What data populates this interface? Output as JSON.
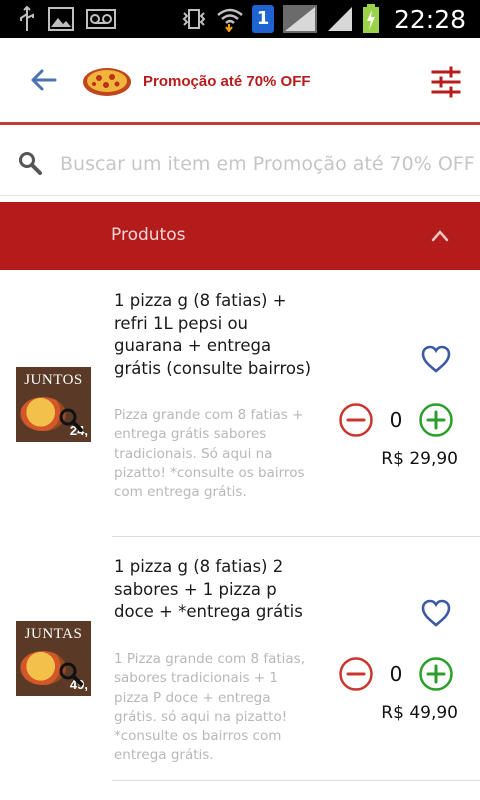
{
  "status_bar": {
    "time": "22:28",
    "sim_badge": "1",
    "icons": [
      "usb-icon",
      "image-icon",
      "voicemail-icon",
      "vibrate-icon",
      "wifi-icon",
      "signal-icon",
      "battery-charging-icon"
    ]
  },
  "header": {
    "title": "Promoção até 70% OFF",
    "back_icon": "arrow-left-icon",
    "filter_icon": "sliders-icon",
    "accent_color": "#b81b1b"
  },
  "search": {
    "placeholder": "Buscar um item em Promoção até 70% OFF"
  },
  "section": {
    "title": "Produtos",
    "expanded": true,
    "background": "#b41c1c"
  },
  "products": [
    {
      "title": "1 pizza g (8 fatias) + refri 1L pepsi ou guarana + entrega grátis (consulte bairros)",
      "description": "Pizza grande com 8 fatias + entrega grátis sabores tradicionais. Só aqui na pizatto! *consulte os bairros com entrega grátis.",
      "quantity": "0",
      "price": "R$ 29,90",
      "thumb_heading": "JUNTOS",
      "thumb_price": "24,"
    },
    {
      "title": "1 pizza g (8 fatias) 2 sabores + 1 pizza p doce + *entrega grátis",
      "description": "1 Pizza grande com 8 fatias, sabores tradicionais + 1 pizza P doce + entrega grátis. só aqui na pizatto! *consulte os bairros com entrega grátis.",
      "quantity": "0",
      "price": "R$ 49,90",
      "thumb_heading": "JUNTAS",
      "thumb_price": "49,"
    }
  ]
}
